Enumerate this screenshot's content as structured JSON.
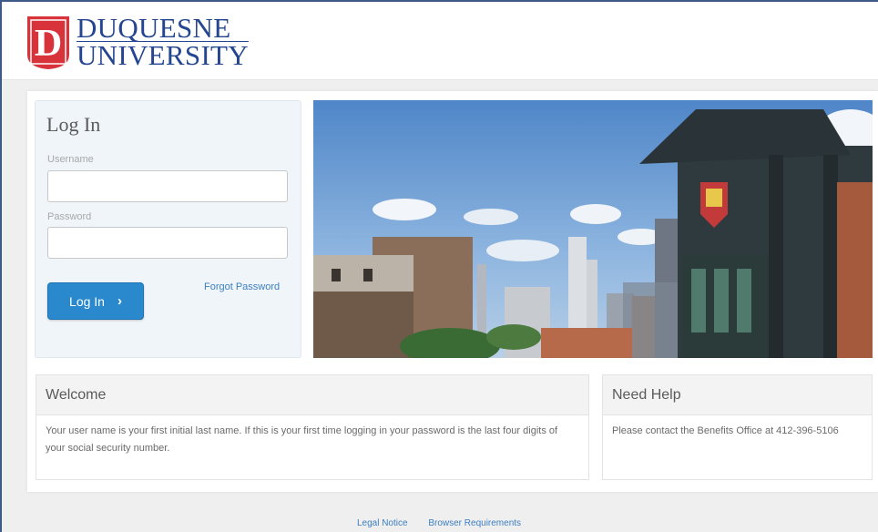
{
  "header": {
    "university_line1": "DUQUESNE",
    "university_line2": "UNIVERSITY",
    "logo_letter": "D",
    "brand_red": "#d8323b",
    "brand_blue": "#24458f"
  },
  "login": {
    "title": "Log In",
    "username_label": "Username",
    "username_value": "",
    "password_label": "Password",
    "password_value": "",
    "button_label": "Log In",
    "button_icon": "chevron-right-icon",
    "forgot_label": "Forgot Password",
    "accent": "#2a89cc"
  },
  "welcome": {
    "title": "Welcome",
    "text": "Your user name is your first initial last name. If this is your first time logging in your password is the last four digits of your social security number."
  },
  "help": {
    "title": "Need Help",
    "text": "Please contact the Benefits Office at 412-396-5106"
  },
  "footer": {
    "links": [
      "Legal Notice",
      "Browser Requirements"
    ]
  }
}
